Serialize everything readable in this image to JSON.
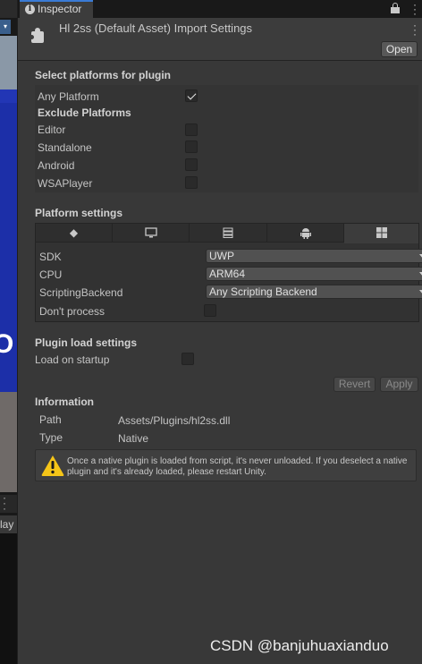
{
  "left_strip": {
    "letter": "O",
    "play_text": "lay"
  },
  "tab": {
    "label": "Inspector"
  },
  "header": {
    "title": "Hl 2ss (Default Asset) Import Settings",
    "open_label": "Open"
  },
  "select_platforms": {
    "title": "Select platforms for plugin",
    "any_platform_label": "Any Platform",
    "any_platform_checked": true,
    "exclude_title": "Exclude Platforms",
    "exclude": [
      {
        "label": "Editor",
        "checked": false
      },
      {
        "label": "Standalone",
        "checked": false
      },
      {
        "label": "Android",
        "checked": false
      },
      {
        "label": "WSAPlayer",
        "checked": false
      }
    ]
  },
  "platform_settings": {
    "title": "Platform settings",
    "tabs": [
      {
        "icon": "unity-logo-icon",
        "glyph": "◆"
      },
      {
        "icon": "monitor-icon",
        "glyph": "🖵"
      },
      {
        "icon": "server-icon",
        "glyph": "☰"
      },
      {
        "icon": "android-icon",
        "glyph": "⚉"
      },
      {
        "icon": "windows-icon",
        "glyph": "⊞",
        "active": true
      }
    ],
    "rows": [
      {
        "label": "SDK",
        "value": "UWP"
      },
      {
        "label": "CPU",
        "value": "ARM64"
      },
      {
        "label": "ScriptingBackend",
        "value": "Any Scripting Backend"
      }
    ],
    "dont_process_label": "Don't process",
    "dont_process_checked": false
  },
  "plugin_load": {
    "title": "Plugin load settings",
    "load_on_startup_label": "Load on startup",
    "load_on_startup_checked": false
  },
  "actions": {
    "revert_label": "Revert",
    "apply_label": "Apply"
  },
  "information": {
    "title": "Information",
    "path_label": "Path",
    "path_value": "Assets/Plugins/hl2ss.dll",
    "type_label": "Type",
    "type_value": "Native",
    "warning": "Once a native plugin is loaded from script, it's never unloaded. If you deselect a native plugin and it's already loaded, please restart Unity."
  },
  "watermark": "CSDN @banjuhuaxianduo",
  "colors": {
    "accent": "#3a7bd5",
    "warning": "#f5c518",
    "background": "#383838"
  }
}
